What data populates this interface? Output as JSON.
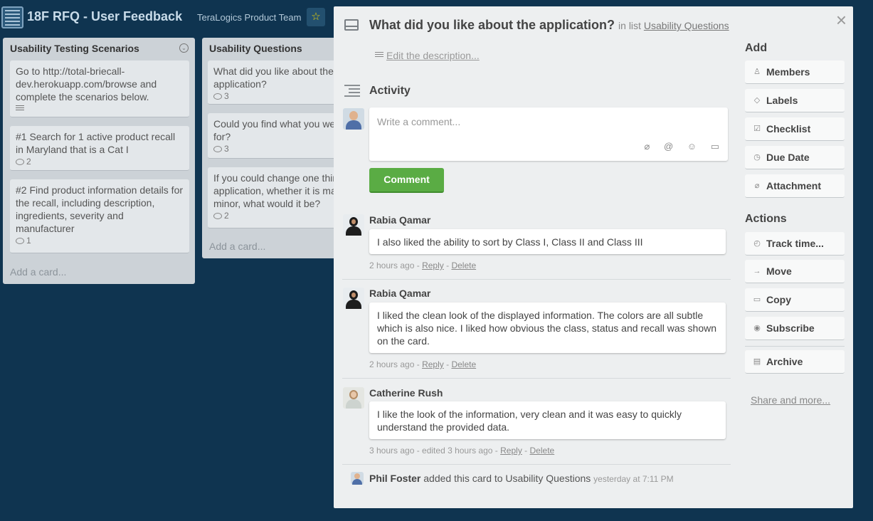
{
  "board": {
    "title": "18F RFQ - User Feedback",
    "team": "TeraLogics Product Team",
    "star_glyph": "☆"
  },
  "lists": [
    {
      "name": "Usability Testing Scenarios",
      "cards": [
        {
          "text": "Go to http://total-briecall-dev.herokuapp.com/browse and complete the scenarios below."
        },
        {
          "text": "#1 Search for 1 active product recall in Maryland that is a Cat I",
          "comments": "2"
        },
        {
          "text": "#2 Find product information details for the recall, including description, ingredients, severity and manufacturer",
          "comments": "1"
        }
      ],
      "add_card": "Add a card..."
    },
    {
      "name": "Usability Questions",
      "cards": [
        {
          "text": "What did you like about the application?",
          "comments": "3"
        },
        {
          "text": "Could you find what you were looking for?",
          "comments": "3"
        },
        {
          "text": "If you could change one thing about the application, whether it is major or minor, what would it be?",
          "comments": "2"
        }
      ],
      "add_card": "Add a card..."
    }
  ],
  "modal": {
    "title": "What did you like about the application?",
    "in_list_prefix": "in list",
    "list_name": "Usability Questions",
    "close": "×",
    "edit_description": "Edit the description...",
    "activity_heading": "Activity",
    "comment_placeholder": "Write a comment...",
    "comment_button": "Comment",
    "comment_icons": [
      "paperclip-icon",
      "mention-icon",
      "emoji-icon",
      "card-icon"
    ],
    "comments": [
      {
        "author": "Rabia Qamar",
        "text": "I also liked the ability to sort by Class I, Class II and Class III",
        "time": "2 hours ago -",
        "reply": "Reply",
        "sep": "-",
        "delete": "Delete"
      },
      {
        "author": "Rabia Qamar",
        "text": "I liked the clean look of the displayed information. The colors are all subtle which is also nice. I liked how obvious the class, status and recall was shown on the card.",
        "time": "2 hours ago -",
        "reply": "Reply",
        "sep": "-",
        "delete": "Delete"
      },
      {
        "author": "Catherine Rush",
        "text": "I like the look of the information, very clean and it was easy to quickly understand the provided data.",
        "time": "3 hours ago - edited 3 hours ago -",
        "reply": "Reply",
        "sep": "-",
        "delete": "Delete"
      }
    ],
    "added": {
      "actor": "Phil Foster",
      "action": "added this card to Usability Questions",
      "time": "yesterday at 7:11 PM"
    }
  },
  "sidebar": {
    "add_heading": "Add",
    "add_buttons": [
      "Members",
      "Labels",
      "Checklist",
      "Due Date",
      "Attachment"
    ],
    "actions_heading": "Actions",
    "action_buttons": [
      "Track time...",
      "Move",
      "Copy",
      "Subscribe"
    ],
    "archive": "Archive",
    "share_more": "Share and more..."
  },
  "colors": {
    "board_bg": "#0f3450",
    "comment_button": "#5aac44"
  }
}
